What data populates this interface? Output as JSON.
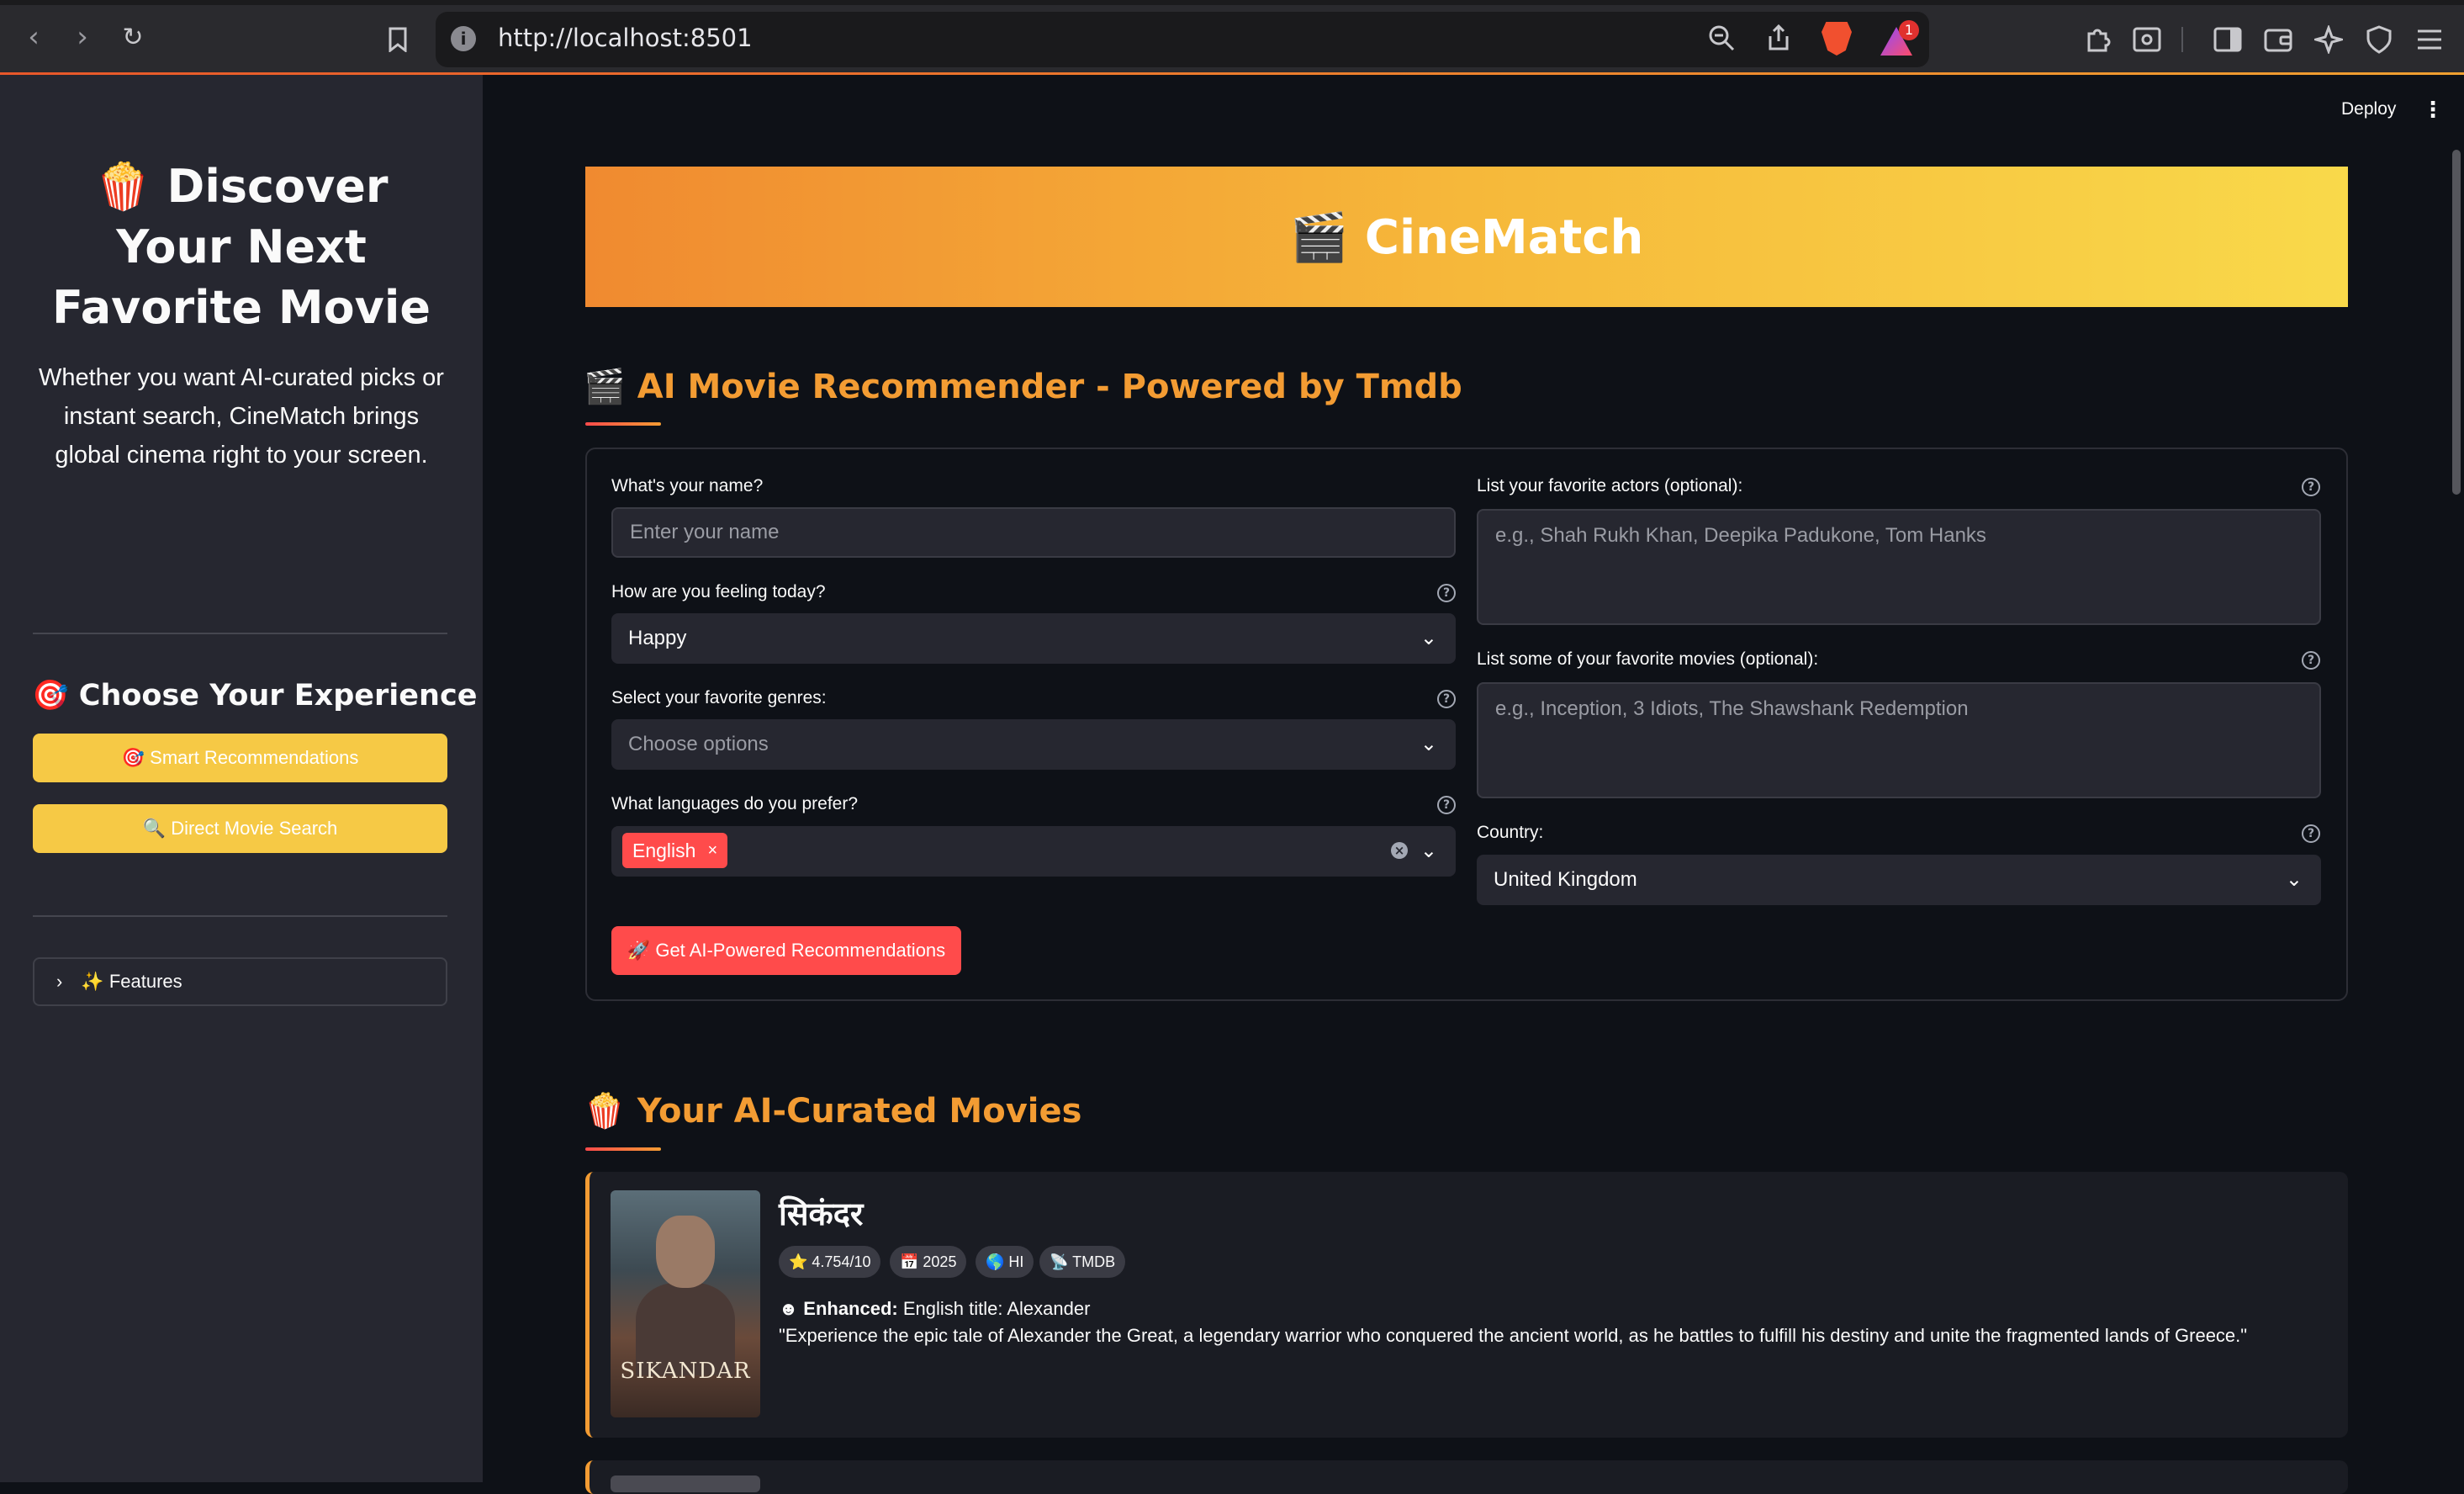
{
  "browser": {
    "url": "http://localhost:8501",
    "notification_count": "1"
  },
  "sidebar": {
    "title": "🍿 Discover Your Next Favorite Movie",
    "description": "Whether you want AI-curated picks or instant search, CineMatch brings global cinema right to your screen.",
    "experience_heading": "🎯 Choose Your Experience",
    "smart_button": "🎯 Smart Recommendations",
    "search_button": "🔍 Direct Movie Search",
    "features_expander": "✨ Features"
  },
  "topbar": {
    "deploy": "Deploy"
  },
  "hero": {
    "title": "🎬 CineMatch"
  },
  "recommender": {
    "heading": "🎬 AI Movie Recommender - Powered by Tmdb",
    "name_label": "What's your name?",
    "name_placeholder": "Enter your name",
    "mood_label": "How are you feeling today?",
    "mood_value": "Happy",
    "genres_label": "Select your favorite genres:",
    "genres_placeholder": "Choose options",
    "languages_label": "What languages do you prefer?",
    "languages_selected": "English",
    "actors_label": "List your favorite actors (optional):",
    "actors_placeholder": "e.g., Shah Rukh Khan, Deepika Padukone, Tom Hanks",
    "movies_label": "List some of your favorite movies (optional):",
    "movies_placeholder": "e.g., Inception, 3 Idiots, The Shawshank Redemption",
    "country_label": "Country:",
    "country_value": "United Kingdom",
    "submit_button": "🚀 Get AI-Powered Recommendations"
  },
  "results": {
    "heading": "🍿 Your AI-Curated Movies",
    "movies": [
      {
        "title": "सिकंदर",
        "poster_text": "SIKANDAR",
        "rating": "⭐ 4.754/10",
        "year": "📅 2025",
        "language": "🌎 HI",
        "source": "📡 TMDB",
        "enhanced_label": "Enhanced:",
        "enhanced_text": "English title: Alexander",
        "overview": "\"Experience the epic tale of Alexander the Great, a legendary warrior who conquered the ancient world, as he battles to fulfill his destiny and unite the fragmented lands of Greece.\""
      }
    ]
  },
  "colors": {
    "accent_orange": "#f39c33",
    "primary_red": "#ff4b4b",
    "sidebar_button_yellow": "#f6c945",
    "background": "#0e1117",
    "sidebar_bg": "#262730"
  }
}
